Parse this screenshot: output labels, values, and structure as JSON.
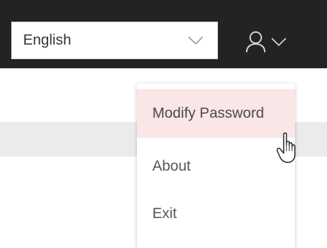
{
  "header": {
    "language_select": {
      "value": "English"
    },
    "user_menu": {
      "icon": "user-icon",
      "caret_icon": "chevron-down-icon"
    }
  },
  "user_dropdown": {
    "items": [
      {
        "label": "Modify Password",
        "state": "hovered"
      },
      {
        "label": "About"
      },
      {
        "label": "Exit"
      }
    ]
  },
  "colors": {
    "topbar": "#232323",
    "hover_bg": "#f9e6e6",
    "strip": "#ebebeb"
  }
}
